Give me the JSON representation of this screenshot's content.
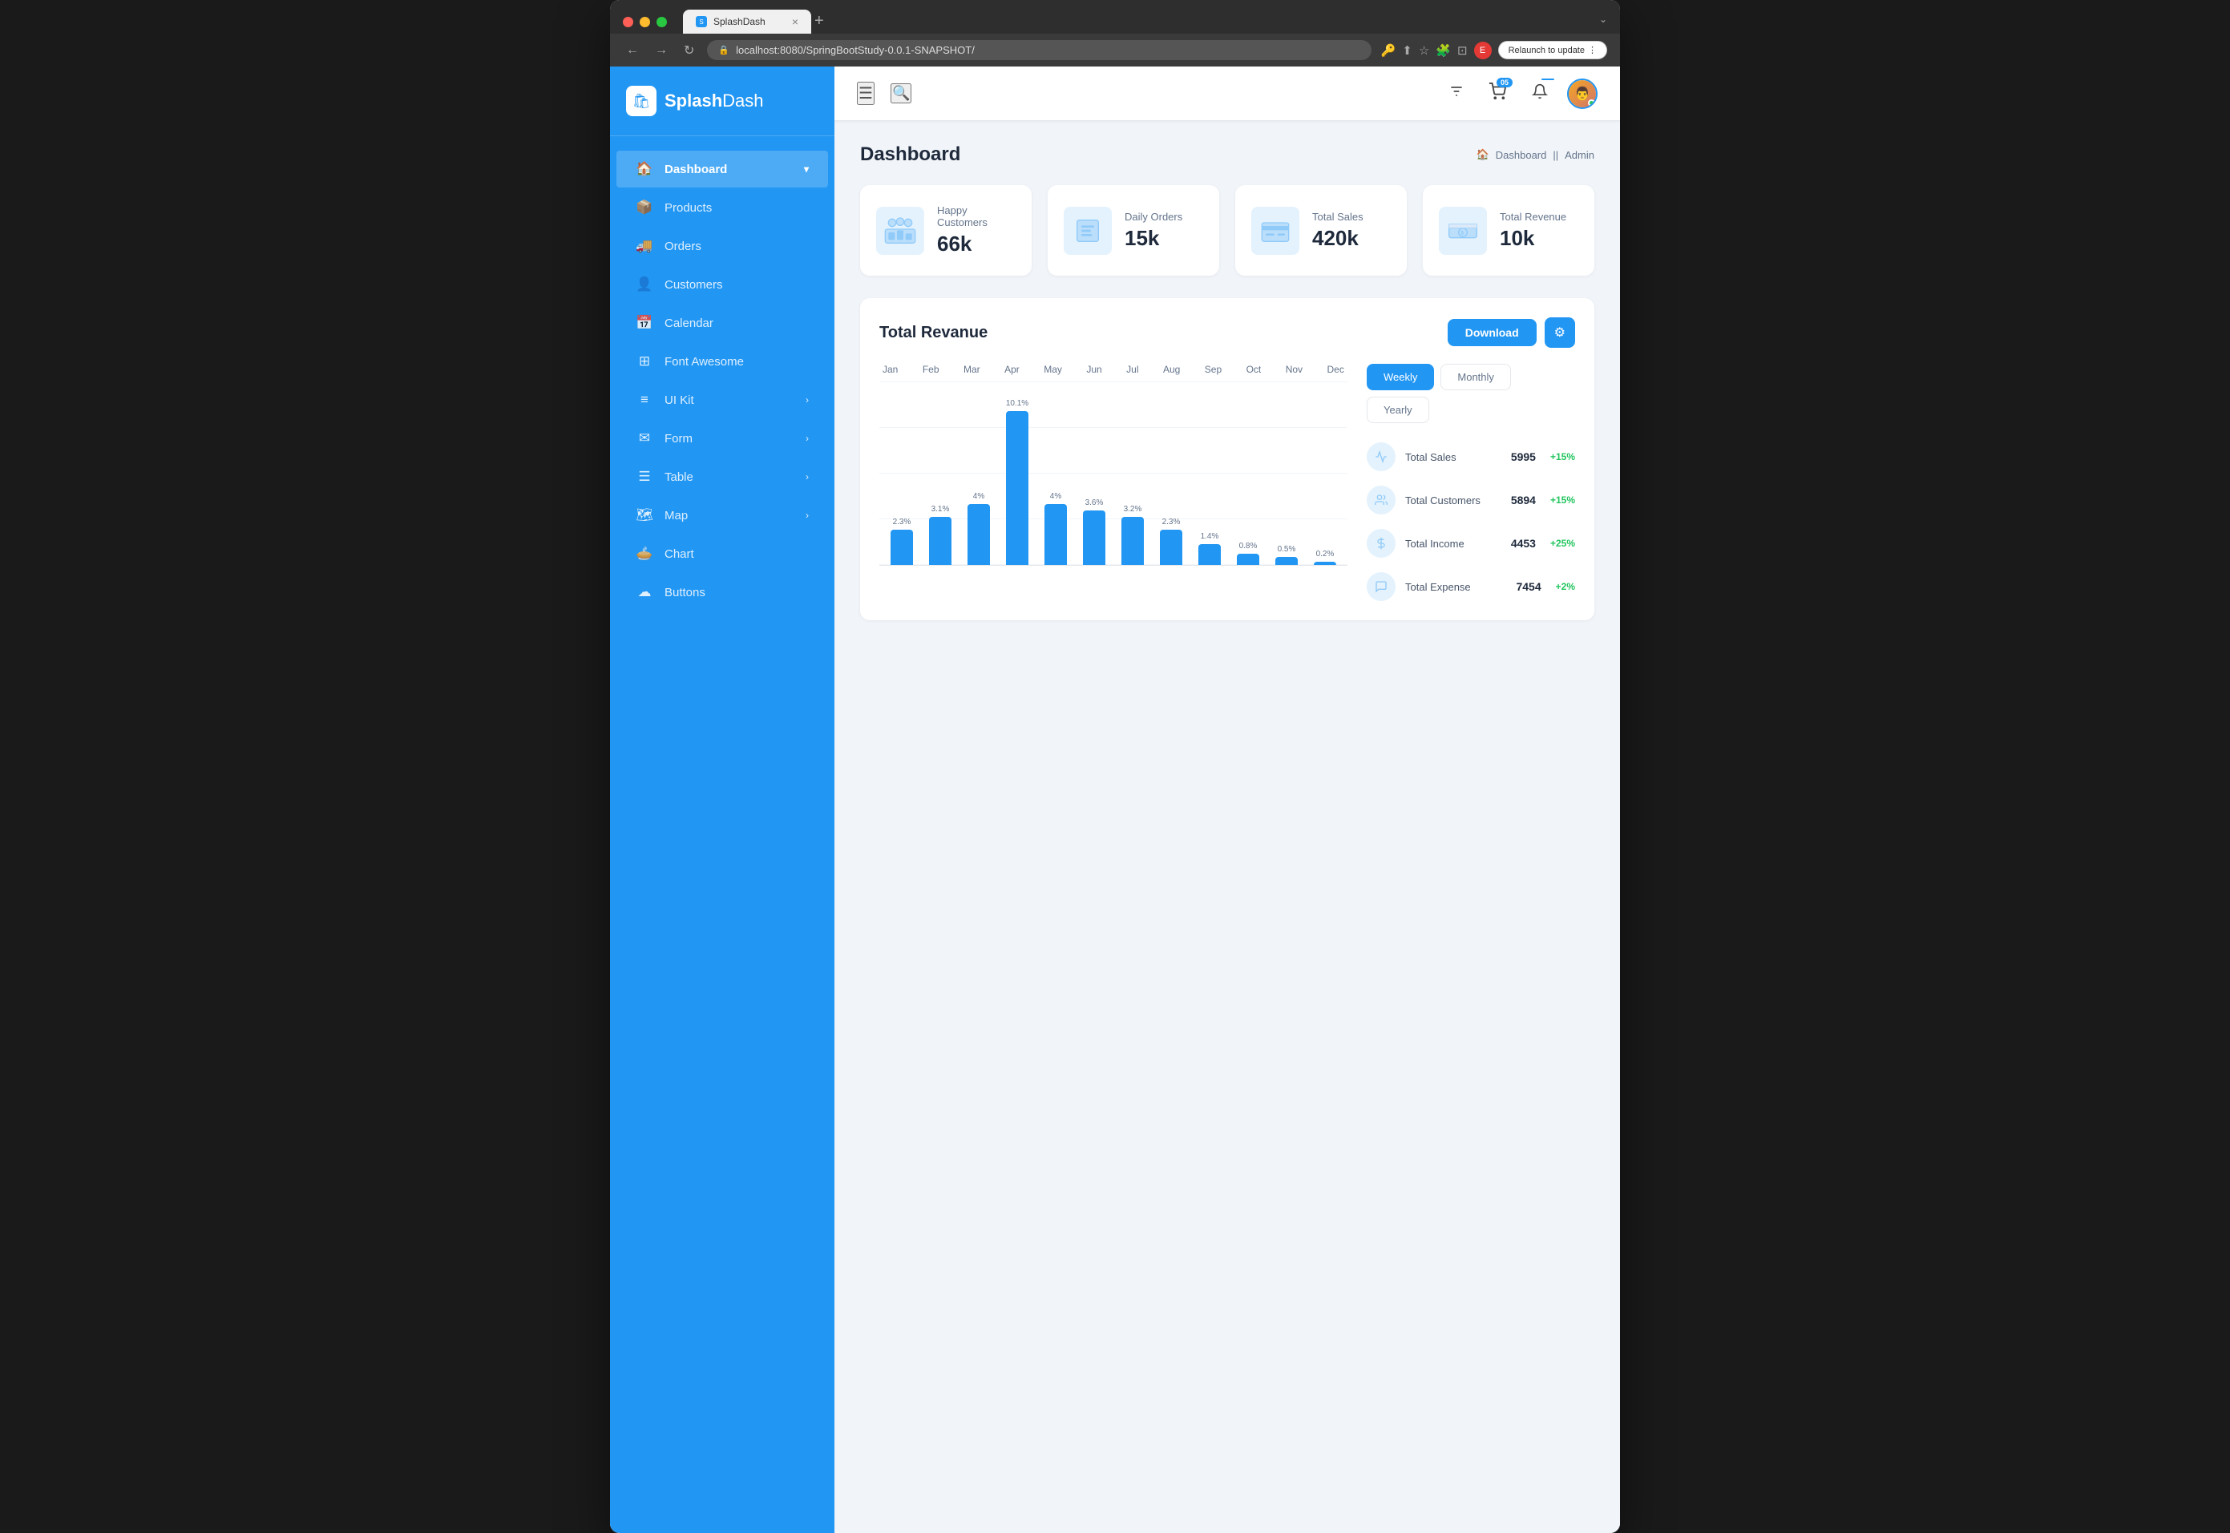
{
  "browser": {
    "url": "localhost:8080/SpringBootStudy-0.0.1-SNAPSHOT/",
    "tab_title": "SplashDash",
    "relaunch_label": "Relaunch to update"
  },
  "sidebar": {
    "logo": "SplashDash",
    "logo_bold": "Splash",
    "logo_light": "Dash",
    "nav_items": [
      {
        "id": "dashboard",
        "label": "Dashboard",
        "icon": "🏠",
        "active": true,
        "has_chevron": true
      },
      {
        "id": "products",
        "label": "Products",
        "icon": "📦",
        "active": false
      },
      {
        "id": "orders",
        "label": "Orders",
        "icon": "🚚",
        "active": false
      },
      {
        "id": "customers",
        "label": "Customers",
        "icon": "👥",
        "active": false
      },
      {
        "id": "calendar",
        "label": "Calendar",
        "icon": "📅",
        "active": false
      },
      {
        "id": "font-awesome",
        "label": "Font Awesome",
        "icon": "⊞",
        "active": false
      },
      {
        "id": "ui-kit",
        "label": "UI Kit",
        "icon": "≡",
        "active": false,
        "has_chevron": true
      },
      {
        "id": "form",
        "label": "Form",
        "icon": "✉",
        "active": false,
        "has_chevron": true
      },
      {
        "id": "table",
        "label": "Table",
        "icon": "☰",
        "active": false,
        "has_chevron": true
      },
      {
        "id": "map",
        "label": "Map",
        "icon": "🗺",
        "active": false,
        "has_chevron": true
      },
      {
        "id": "chart",
        "label": "Chart",
        "icon": "🥧",
        "active": false
      },
      {
        "id": "buttons",
        "label": "Buttons",
        "icon": "☁",
        "active": false
      }
    ]
  },
  "header": {
    "cart_badge": "05",
    "bell_badge": ""
  },
  "page": {
    "title": "Dashboard",
    "breadcrumb_home": "Dashboard",
    "breadcrumb_sep": "||",
    "breadcrumb_page": "Admin"
  },
  "stat_cards": [
    {
      "id": "happy-customers",
      "label": "Happy Customers",
      "value": "66k",
      "icon": "👥"
    },
    {
      "id": "daily-orders",
      "label": "Daily Orders",
      "value": "15k",
      "icon": "🏠"
    },
    {
      "id": "total-sales",
      "label": "Total Sales",
      "value": "420k",
      "icon": "🏪"
    },
    {
      "id": "total-revenue",
      "label": "Total Revenue",
      "value": "10k",
      "icon": "💰"
    }
  ],
  "revenue": {
    "title": "Total Revanue",
    "download_btn": "Download",
    "period_buttons": [
      {
        "id": "weekly",
        "label": "Weekly",
        "active": true
      },
      {
        "id": "monthly",
        "label": "Monthly",
        "active": false
      },
      {
        "id": "yearly",
        "label": "Yearly",
        "active": false
      }
    ],
    "chart_months": [
      "Jan",
      "Feb",
      "Mar",
      "Apr",
      "May",
      "Jun",
      "Jul",
      "Aug",
      "Sep",
      "Oct",
      "Nov",
      "Dec"
    ],
    "chart_bars": [
      {
        "month": "Jan",
        "value": 2.3,
        "height_pct": 22
      },
      {
        "month": "Feb",
        "value": 3.1,
        "height_pct": 30
      },
      {
        "month": "Mar",
        "value": 4,
        "height_pct": 38
      },
      {
        "month": "Apr",
        "value": 10.1,
        "height_pct": 96
      },
      {
        "month": "May",
        "value": 4,
        "height_pct": 38
      },
      {
        "month": "Jun",
        "value": 3.6,
        "height_pct": 34
      },
      {
        "month": "Jul",
        "value": 3.2,
        "height_pct": 30
      },
      {
        "month": "Aug",
        "value": 2.3,
        "height_pct": 22
      },
      {
        "month": "Sep",
        "value": 1.4,
        "height_pct": 13
      },
      {
        "month": "Oct",
        "value": 0.8,
        "height_pct": 7
      },
      {
        "month": "Nov",
        "value": 0.5,
        "height_pct": 5
      },
      {
        "month": "Dec",
        "value": 0.2,
        "height_pct": 2
      }
    ],
    "stats": [
      {
        "id": "total-sales-stat",
        "label": "Total Sales",
        "value": "5995",
        "change": "+15%",
        "icon": "📊"
      },
      {
        "id": "total-customers-stat",
        "label": "Total Customers",
        "value": "5894",
        "change": "+15%",
        "icon": "👥"
      },
      {
        "id": "total-income-stat",
        "label": "Total Income",
        "value": "4453",
        "change": "+25%",
        "icon": "💵"
      },
      {
        "id": "total-expense-stat",
        "label": "Total Expense",
        "value": "7454",
        "change": "+2%",
        "icon": "📉"
      }
    ]
  }
}
